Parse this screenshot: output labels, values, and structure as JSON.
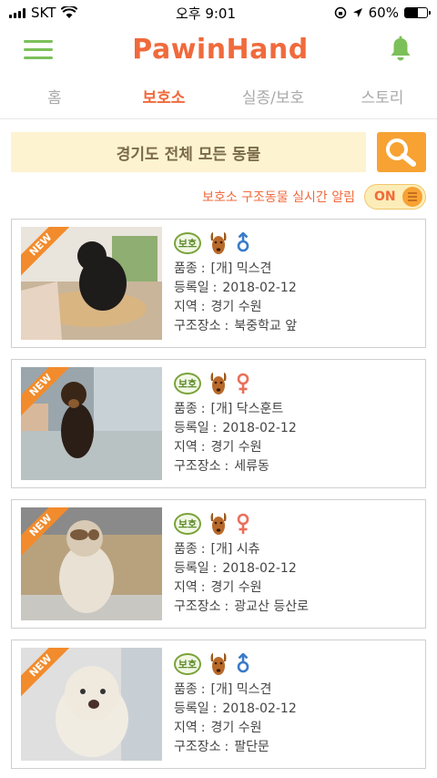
{
  "status": {
    "carrier": "SKT",
    "time": "오후 9:01",
    "battery": "60%",
    "battery_level": 0.6
  },
  "header": {
    "logo": "PawinHand"
  },
  "tabs": [
    {
      "label": "홈",
      "active": false
    },
    {
      "label": "보호소",
      "active": true
    },
    {
      "label": "실종/보호",
      "active": false
    },
    {
      "label": "스토리",
      "active": false
    }
  ],
  "filter": {
    "label": "경기도 전체  모든 동물"
  },
  "alert": {
    "label": "보호소 구조동물 실시간 알림",
    "toggle": "ON"
  },
  "field_labels": {
    "breed": "품종",
    "date": "등록일",
    "region": "지역",
    "place": "구조장소"
  },
  "cards": [
    {
      "badge": "보호",
      "ribbon": "NEW",
      "gender": "male",
      "breed": "[개] 믹스견",
      "date": "2018-02-12",
      "region": "경기 수원",
      "place": "북중학교 앞"
    },
    {
      "badge": "보호",
      "ribbon": "NEW",
      "gender": "female",
      "breed": "[개] 닥스훈트",
      "date": "2018-02-12",
      "region": "경기 수원",
      "place": "세류동"
    },
    {
      "badge": "보호",
      "ribbon": "NEW",
      "gender": "female",
      "breed": "[개] 시츄",
      "date": "2018-02-12",
      "region": "경기 수원",
      "place": "광교산 등산로"
    },
    {
      "badge": "보호",
      "ribbon": "NEW",
      "gender": "male",
      "breed": "[개] 믹스견",
      "date": "2018-02-12",
      "region": "경기 수원",
      "place": "팔단문"
    }
  ],
  "colors": {
    "accent": "#f06a3c",
    "green": "#7cc05a",
    "male": "#3a7bc8",
    "female": "#e8705a"
  }
}
